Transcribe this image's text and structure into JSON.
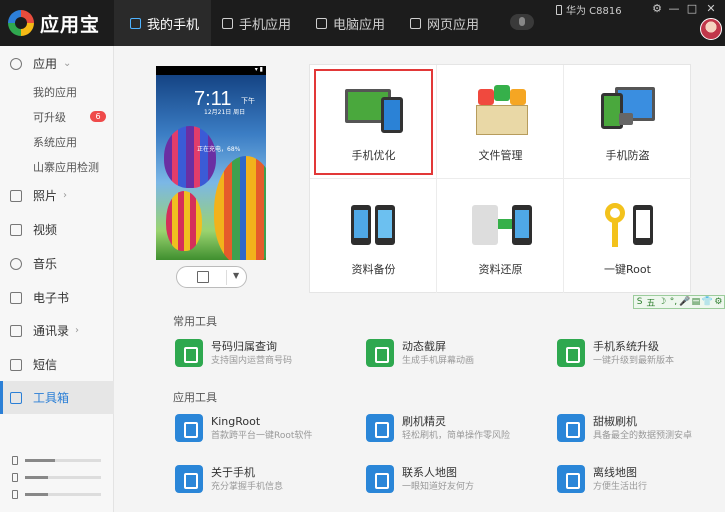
{
  "app": {
    "name": "应用宝"
  },
  "tabs": [
    {
      "label": "我的手机",
      "active": true
    },
    {
      "label": "手机应用"
    },
    {
      "label": "电脑应用"
    },
    {
      "label": "网页应用"
    }
  ],
  "device": {
    "name": "华为 C8816"
  },
  "window_controls": [
    "⚙",
    "—",
    "□",
    "✕"
  ],
  "sidebar": {
    "apps_label": "应用",
    "apps_sub": [
      "我的应用",
      "可升级",
      "系统应用",
      "山寨应用检测"
    ],
    "upgrade_badge": "6",
    "items": [
      "照片",
      "视频",
      "音乐",
      "电子书",
      "通讯录",
      "短信",
      "工具箱"
    ],
    "active": "工具箱"
  },
  "storage": [
    {
      "fill_fraction": 0.4
    },
    {
      "fill_fraction": 0.3
    },
    {
      "fill_fraction": 0.3
    }
  ],
  "phone": {
    "status_right": "▾ ▮",
    "time": "7:11",
    "ampm": "下午",
    "date": "12月21日 周日",
    "charging": "正在充电，68%"
  },
  "tiles": [
    "手机优化",
    "文件管理",
    "手机防盗",
    "资料备份",
    "资料还原",
    "一键Root"
  ],
  "ime_bar": [
    "S",
    "五",
    "☽",
    "°,",
    "🎤",
    "▤",
    "👕",
    "⚙"
  ],
  "sections": {
    "common": {
      "title": "常用工具",
      "items": [
        {
          "name": "号码归属查询",
          "desc": "支持国内运营商号码",
          "color": "#2ea84f"
        },
        {
          "name": "动态截屏",
          "desc": "生成手机屏幕动画",
          "color": "#2ea84f"
        },
        {
          "name": "手机系统升级",
          "desc": "一键升级到最新版本",
          "color": "#2ea84f"
        }
      ]
    },
    "app": {
      "title": "应用工具",
      "items": [
        {
          "name": "KingRoot",
          "desc": "首款跨平台一键Root软件",
          "color": "#2a86d8"
        },
        {
          "name": "刷机精灵",
          "desc": "轻松刷机，简单操作零风险",
          "color": "#2a86d8"
        },
        {
          "name": "甜椒刷机",
          "desc": "具备最全的数据预测安卓",
          "color": "#2a86d8"
        },
        {
          "name": "关于手机",
          "desc": "充分掌握手机信息",
          "color": "#2a86d8"
        },
        {
          "name": "联系人地图",
          "desc": "一眼知道好友何方",
          "color": "#2a86d8"
        },
        {
          "name": "离线地图",
          "desc": "方便生活出行",
          "color": "#2a86d8"
        }
      ]
    }
  }
}
